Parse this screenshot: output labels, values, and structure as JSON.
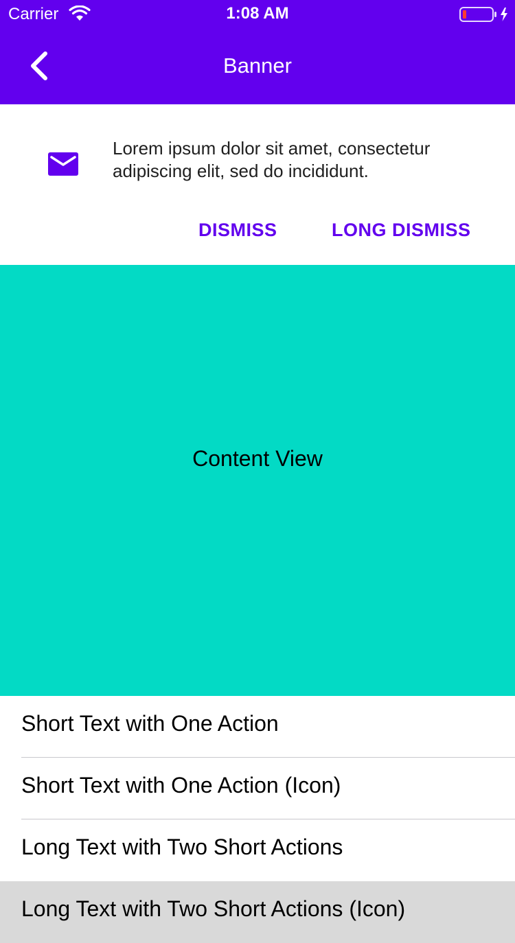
{
  "status_bar": {
    "carrier": "Carrier",
    "time": "1:08 AM",
    "battery_color": "#ff3b30",
    "wifi_icon": "wifi-icon",
    "battery_icon": "battery-icon"
  },
  "nav": {
    "title": "Banner",
    "back_icon": "chevron-left-icon",
    "background": "#6200ee"
  },
  "banner": {
    "icon": "mail-icon",
    "text": "Lorem ipsum dolor sit amet, consectetur adipiscing elit, sed do incididunt.",
    "actions": [
      {
        "label": "DISMISS"
      },
      {
        "label": "LONG DISMISS"
      }
    ],
    "accent_color": "#6200ee"
  },
  "content": {
    "label": "Content View",
    "background": "#03dac5"
  },
  "list": {
    "items": [
      {
        "label": "Short Text with One Action"
      },
      {
        "label": "Short Text with One Action (Icon)"
      },
      {
        "label": "Long Text with Two Short Actions"
      },
      {
        "label": "Long Text with Two Short Actions (Icon)"
      }
    ],
    "selected_index": 3
  }
}
